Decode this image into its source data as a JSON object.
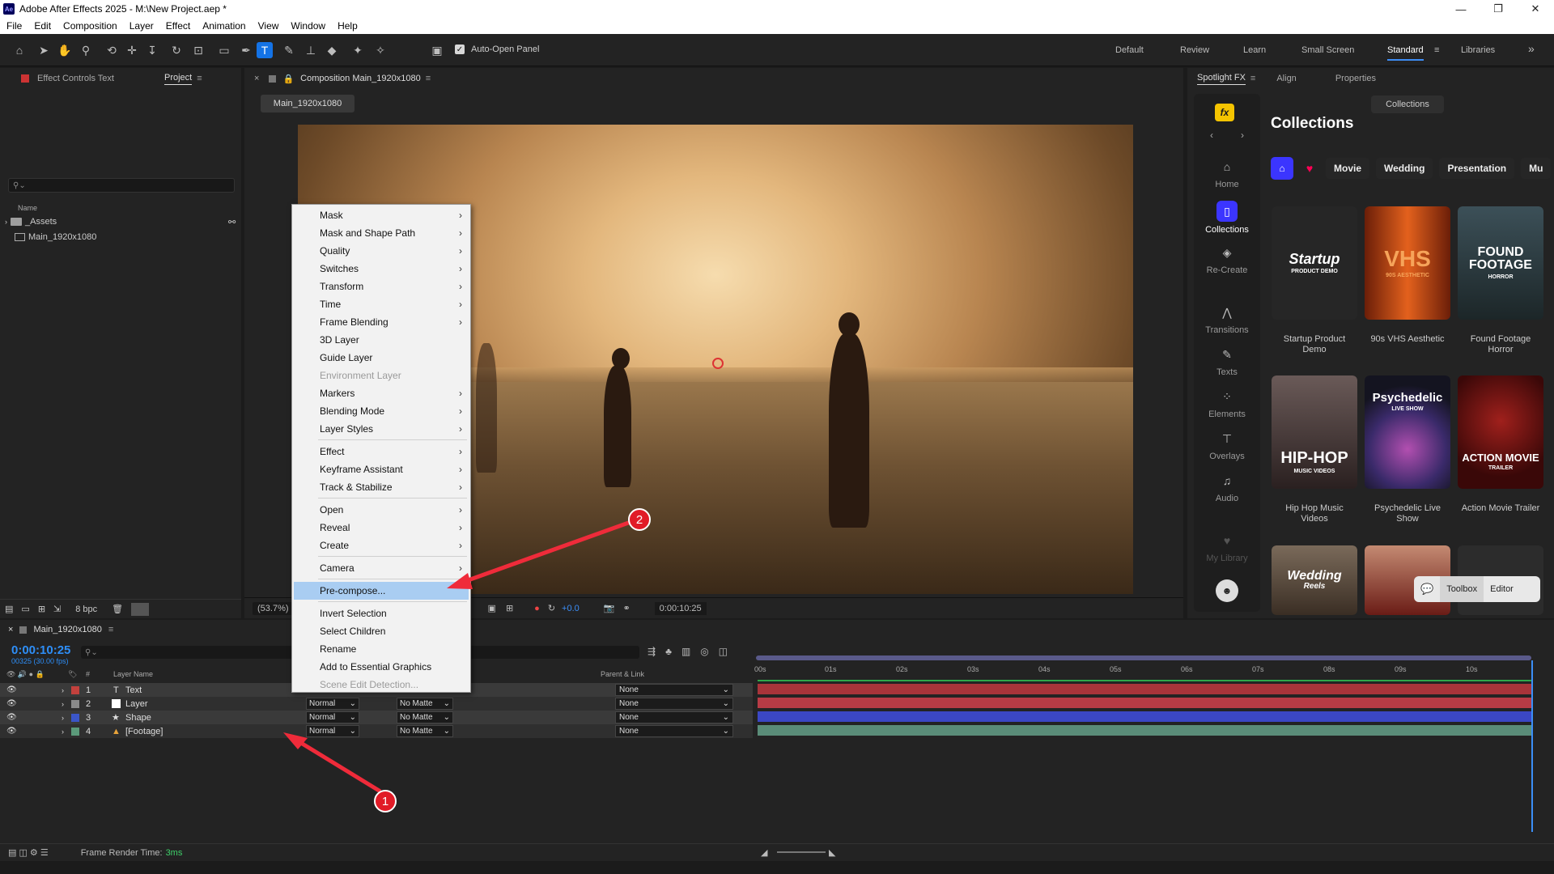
{
  "window": {
    "title": "Adobe After Effects 2025 - M:\\New Project.aep *",
    "logo": "Ae",
    "controls": [
      "minimize-icon",
      "restore-icon",
      "close-icon"
    ]
  },
  "menubar": [
    "File",
    "Edit",
    "Composition",
    "Layer",
    "Effect",
    "Animation",
    "View",
    "Window",
    "Help"
  ],
  "toolbar": {
    "auto_open_label": "Auto-Open Panel",
    "auto_open_checked": true,
    "workspaces": [
      "Default",
      "Review",
      "Learn",
      "Small Screen",
      "Standard",
      "Libraries"
    ],
    "active_workspace": "Standard",
    "more": "»"
  },
  "project_panel": {
    "tabs": [
      "Effect Controls Text",
      "Project"
    ],
    "active_tab": "Project",
    "column_name": "Name",
    "items": [
      {
        "name": "_Assets",
        "type": "folder"
      },
      {
        "name": "Main_1920x1080",
        "type": "composition"
      }
    ],
    "bpc": "8 bpc"
  },
  "composition_panel": {
    "tab_label": "Composition Main_1920x1080",
    "comp_button": "Main_1920x1080",
    "zoom": "(53.7%)",
    "exposure": "+0.0",
    "timecode": "0:00:10:25"
  },
  "context_menu": {
    "items": [
      {
        "label": "Mask",
        "submenu": true
      },
      {
        "label": "Mask and Shape Path",
        "submenu": true
      },
      {
        "label": "Quality",
        "submenu": true
      },
      {
        "label": "Switches",
        "submenu": true
      },
      {
        "label": "Transform",
        "submenu": true
      },
      {
        "label": "Time",
        "submenu": true
      },
      {
        "label": "Frame Blending",
        "submenu": true
      },
      {
        "label": "3D Layer",
        "submenu": false
      },
      {
        "label": "Guide Layer",
        "submenu": false
      },
      {
        "label": "Environment Layer",
        "submenu": false,
        "disabled": true
      },
      {
        "label": "Markers",
        "submenu": true
      },
      {
        "label": "Blending Mode",
        "submenu": true
      },
      {
        "label": "Layer Styles",
        "submenu": true
      },
      {
        "label": "Effect",
        "submenu": true
      },
      {
        "label": "Keyframe Assistant",
        "submenu": true
      },
      {
        "label": "Track & Stabilize",
        "submenu": true
      },
      {
        "label": "Open",
        "submenu": true
      },
      {
        "label": "Reveal",
        "submenu": true
      },
      {
        "label": "Create",
        "submenu": true
      },
      {
        "label": "Camera",
        "submenu": true
      },
      {
        "label": "Pre-compose...",
        "submenu": false,
        "highlighted": true
      },
      {
        "label": "Invert Selection",
        "submenu": false
      },
      {
        "label": "Select Children",
        "submenu": false
      },
      {
        "label": "Rename",
        "submenu": false
      },
      {
        "label": "Add to Essential Graphics",
        "submenu": false
      },
      {
        "label": "Scene Edit Detection...",
        "submenu": false,
        "disabled": true
      }
    ]
  },
  "spotlight": {
    "tabs": [
      "Spotlight FX",
      "Align",
      "Properties"
    ],
    "active_tab": "Spotlight FX",
    "fx_badge": "fx",
    "collections_button": "Collections",
    "title": "Collections",
    "filters": [
      "Movie",
      "Wedding",
      "Presentation",
      "Mu"
    ],
    "nav": [
      {
        "label": "Home",
        "icon": "home-icon"
      },
      {
        "label": "Collections",
        "icon": "collections-icon",
        "active": true
      },
      {
        "label": "Re-Create",
        "icon": "layers-icon"
      },
      {
        "label": "Transitions",
        "icon": "transitions-icon"
      },
      {
        "label": "Texts",
        "icon": "pen-icon"
      },
      {
        "label": "Elements",
        "icon": "grid-icon"
      },
      {
        "label": "Overlays",
        "icon": "drop-icon"
      },
      {
        "label": "Audio",
        "icon": "music-icon"
      },
      {
        "label": "My Library",
        "icon": "heart-icon",
        "disabled": true
      }
    ],
    "cards": [
      {
        "caption": "Startup Product Demo",
        "thumb_text": "Startup",
        "thumb_sub": "PRODUCT DEMO",
        "color": "#262626"
      },
      {
        "caption": "90s VHS Aesthetic",
        "thumb_text": "VHS",
        "thumb_sub": "90S AESTHETIC",
        "color": "#c24a12"
      },
      {
        "caption": "Found Footage Horror",
        "thumb_text": "FOUND FOOTAGE",
        "thumb_sub": "HORROR",
        "color": "#2a3a3f"
      },
      {
        "caption": "Hip Hop Music Videos",
        "thumb_text": "HIP-HOP",
        "thumb_sub": "MUSIC VIDEOS",
        "color": "#3a2a2a"
      },
      {
        "caption": "Psychedelic Live Show",
        "thumb_text": "Psychedelic",
        "thumb_sub": "LIVE SHOW",
        "color": "#1e1e2a"
      },
      {
        "caption": "Action Movie Trailer",
        "thumb_text": "ACTION MOVIE",
        "thumb_sub": "TRAILER",
        "color": "#5a1010"
      },
      {
        "caption": "",
        "thumb_text": "Wedding",
        "thumb_sub": "Reels",
        "color": "#5d4a3c"
      },
      {
        "caption": "",
        "thumb_text": "",
        "thumb_sub": "",
        "color": "#7a2a20"
      },
      {
        "caption": "",
        "thumb_text": "",
        "thumb_sub": "",
        "color": "#2c2c2c"
      }
    ],
    "toolbox": {
      "toolbox_label": "Toolbox",
      "editor_label": "Editor"
    }
  },
  "timeline": {
    "tab_label": "Main_1920x1080",
    "timecode": "0:00:10:25",
    "fps": "00325 (30.00 fps)",
    "col_layer_name": "Layer Name",
    "col_parent": "Parent & Link",
    "layers": [
      {
        "num": "1",
        "name": "Text",
        "type_icon": "T",
        "label_color": "#c2413d",
        "mode": "",
        "matte": "",
        "parent": "None",
        "bar_color": "#a8343a"
      },
      {
        "num": "2",
        "name": "Layer",
        "type_icon": "□",
        "label_color": "#8a8a8a",
        "mode": "Normal",
        "matte": "No Matte",
        "parent": "None",
        "bar_color": "#b73b45"
      },
      {
        "num": "3",
        "name": "Shape",
        "type_icon": "★",
        "label_color": "#3b56c8",
        "mode": "Normal",
        "matte": "No Matte",
        "parent": "None",
        "bar_color": "#3b47c4"
      },
      {
        "num": "4",
        "name": "[Footage]",
        "type_icon": "▲",
        "label_color": "#5b9a7a",
        "mode": "Normal",
        "matte": "No Matte",
        "parent": "None",
        "bar_color": "#5a8c78"
      }
    ],
    "ruler": [
      "00s",
      "01s",
      "02s",
      "03s",
      "04s",
      "05s",
      "06s",
      "07s",
      "08s",
      "09s",
      "10s"
    ],
    "render_time_label": "Frame Render Time:",
    "render_time_value": "3ms"
  },
  "annotations": [
    "1",
    "2"
  ],
  "colors": {
    "accent": "#2e8ef7",
    "highlight": "#a9cdf2",
    "marker": "#e11b27"
  }
}
